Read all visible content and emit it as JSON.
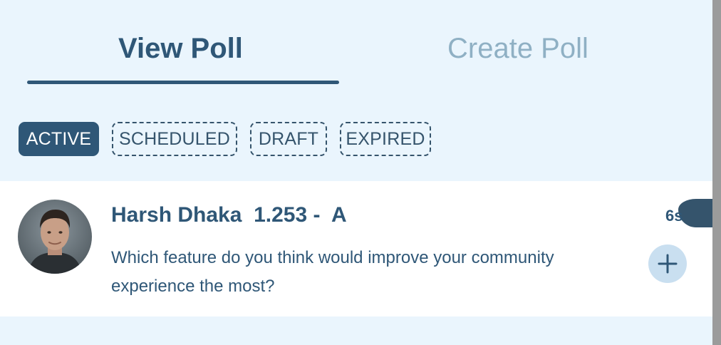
{
  "tabs": {
    "view_poll": "View Poll",
    "create_poll": "Create Poll"
  },
  "filters": [
    {
      "label": "ACTIVE",
      "selected": true
    },
    {
      "label": "SCHEDULED",
      "selected": false
    },
    {
      "label": "DRAFT",
      "selected": false
    },
    {
      "label": "EXPIRED",
      "selected": false
    }
  ],
  "poll": {
    "author": "Harsh Dhaka  1.253 -  A",
    "question": "Which feature do you think would improve your community experience the most?",
    "time": "6s",
    "avatar": "user-avatar",
    "add_icon": "plus-icon"
  },
  "colors": {
    "primary": "#2f5777",
    "background": "#eaf5fd",
    "muted_tab": "#8fb0c4",
    "add_button": "#c9dff0"
  }
}
